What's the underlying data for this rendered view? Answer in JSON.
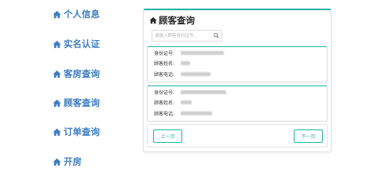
{
  "sidebar": {
    "items": [
      {
        "label": "个人信息"
      },
      {
        "label": "实名认证"
      },
      {
        "label": "客房查询"
      },
      {
        "label": "顾客查询"
      },
      {
        "label": "订单查询"
      },
      {
        "label": "开房"
      }
    ]
  },
  "panel": {
    "title": "顾客查询",
    "search": {
      "placeholder": "请输入顾客身份证号..."
    }
  },
  "fields": {
    "id_label": "身份证号:",
    "name_label": "顾客姓名:",
    "phone_label": "顾客电话:"
  },
  "pager": {
    "prev_label": "上一页",
    "next_label": "下一页"
  },
  "colors": {
    "accent": "#20b2a5",
    "sidebar_text": "#3f7fc1"
  },
  "icons": {
    "sidebar": "home-icon",
    "title": "home-icon",
    "search": "search-icon"
  }
}
